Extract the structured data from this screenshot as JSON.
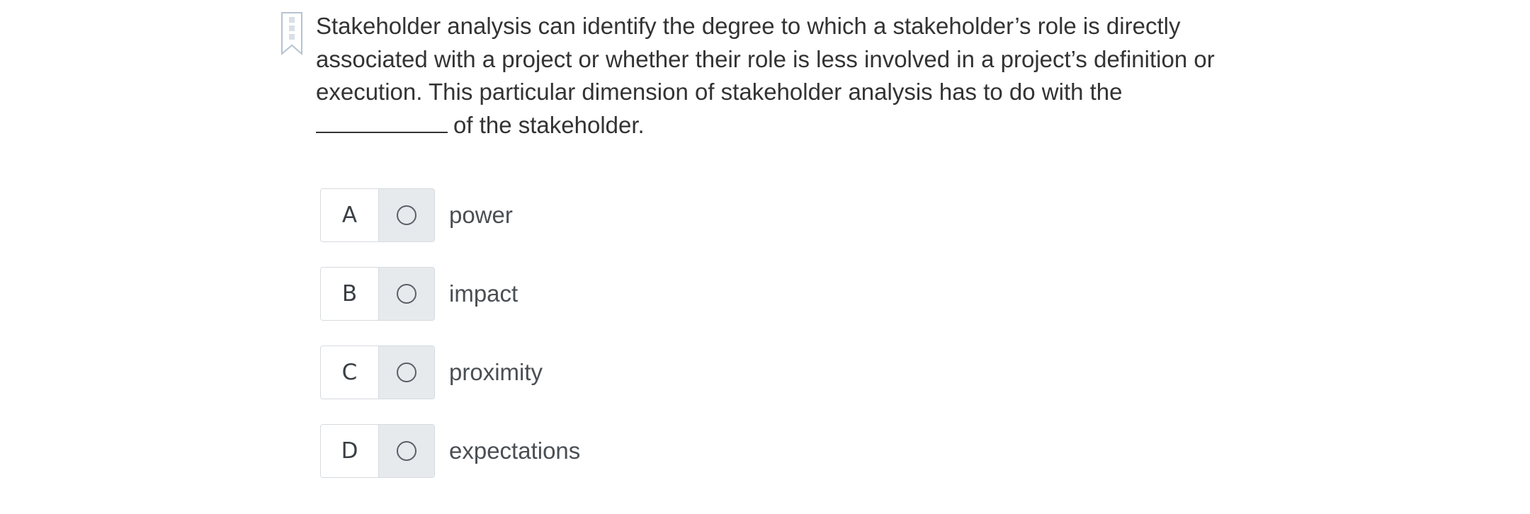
{
  "question": {
    "line1": "Stakeholder analysis can identify the degree to which a stakeholder’s role is directly",
    "line2": "associated with a project or whether their role is less involved in a project’s definition or",
    "line3": "execution. This particular dimension of stakeholder analysis has to do with the",
    "line4_suffix": "of the stakeholder."
  },
  "options": [
    {
      "letter": "A",
      "label": "power"
    },
    {
      "letter": "B",
      "label": "impact"
    },
    {
      "letter": "C",
      "label": "proximity"
    },
    {
      "letter": "D",
      "label": "expectations"
    }
  ],
  "colors": {
    "text": "#333333",
    "option_border": "#d6dadf",
    "radio_cell_bg": "#e7eaed",
    "bookmark": "#b6c3d1"
  },
  "icons": {
    "bookmark": "bookmark-icon",
    "radio": "radio-unchecked-icon"
  }
}
